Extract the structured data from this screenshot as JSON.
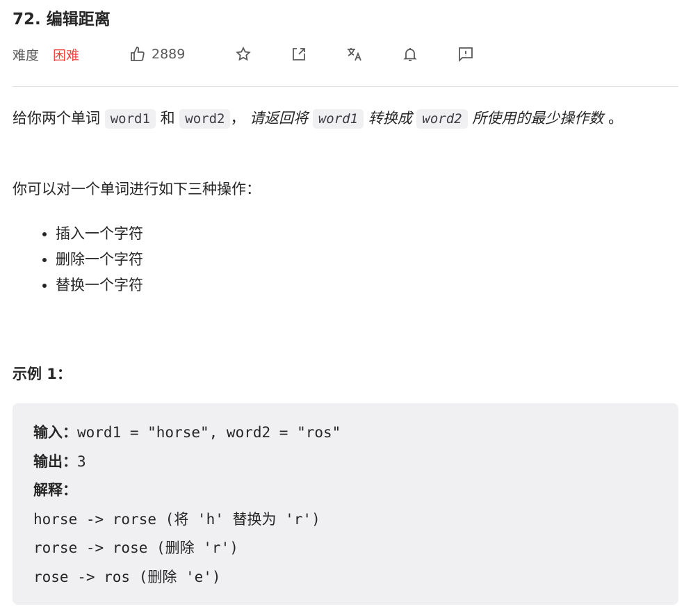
{
  "title": "72. 编辑距离",
  "meta": {
    "difficulty_label": "难度",
    "difficulty": "困难",
    "likes": "2889",
    "difficulty_color": "#ef4743"
  },
  "icons": [
    "thumbs-up-icon",
    "star-icon",
    "share-icon",
    "translate-icon",
    "bell-icon",
    "feedback-icon"
  ],
  "desc": {
    "t1": "给你两个单词 ",
    "c1": "word1",
    "t2": " 和 ",
    "c2": "word2",
    "t3": "， ",
    "t4": "请返回将 ",
    "c3": "word1",
    "t5": " 转换成 ",
    "c4": "word2",
    "t6": " 所使用的最少操作数",
    "t7": " 。"
  },
  "p2": "你可以对一个单词进行如下三种操作：",
  "ops": [
    "插入一个字符",
    "删除一个字符",
    "替换一个字符"
  ],
  "example": {
    "title": "示例 1：",
    "in_label": "输入：",
    "in": "word1 = \"horse\", word2 = \"ros\"",
    "out_label": "输出：",
    "out": "3",
    "exp_label": "解释：",
    "lines": [
      "horse -> rorse (将 'h' 替换为 'r')",
      "rorse -> rose (删除 'r')",
      "rose -> ros (删除 'e')"
    ]
  }
}
